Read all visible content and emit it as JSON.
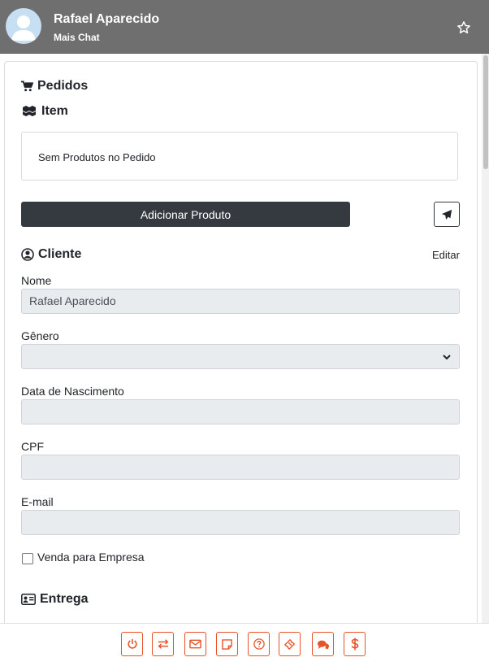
{
  "header": {
    "name": "Rafael Aparecido",
    "subtitle": "Mais Chat"
  },
  "order": {
    "title": "Pedidos",
    "item_title": "Item",
    "empty_message": "Sem Produtos no Pedido",
    "add_button": "Adicionar Produto"
  },
  "client": {
    "title": "Cliente",
    "edit_link": "Editar",
    "fields": [
      {
        "label": "Nome",
        "value": "Rafael Aparecido"
      },
      {
        "label": "Gênero",
        "value": ""
      },
      {
        "label": "Data de Nascimento",
        "value": ""
      },
      {
        "label": "CPF",
        "value": ""
      },
      {
        "label": "E-mail",
        "value": ""
      }
    ],
    "company_checkbox": "Venda para Empresa"
  },
  "delivery": {
    "title": "Entrega"
  },
  "footer": {
    "buttons": [
      "power-icon",
      "transfer-icon",
      "envelope-icon",
      "note-icon",
      "help-icon",
      "ticket-icon",
      "chat-icon",
      "dollar-icon"
    ]
  },
  "colors": {
    "header_bg": "#6f6f6f",
    "dark_button": "#343a40",
    "accent_orange": "#e8542a",
    "input_bg": "#e9ecef"
  }
}
